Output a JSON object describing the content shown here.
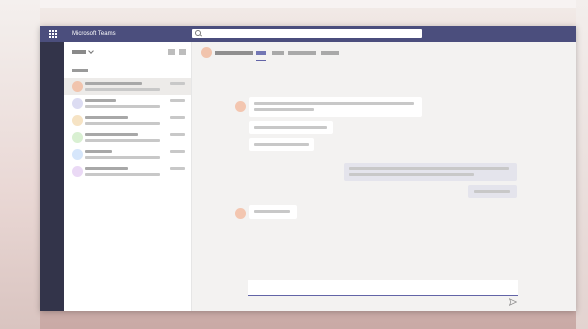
{
  "window": {
    "app_title": "Microsoft Teams",
    "search": {
      "value": "",
      "placeholder": ""
    }
  },
  "colors": {
    "titlebar": "#4b4e7d",
    "rail": "#33344a",
    "accent": "#6264a7",
    "avatar_colors": [
      "#f1c4ad",
      "#dcdcf2",
      "#f6e3c4",
      "#d9f0d2",
      "#d6e6fb",
      "#ead9f5"
    ]
  },
  "icons": [
    "app-launcher-icon",
    "search-icon",
    "filter-chevron-icon",
    "filter-icon",
    "new-chat-icon",
    "send-icon"
  ]
}
